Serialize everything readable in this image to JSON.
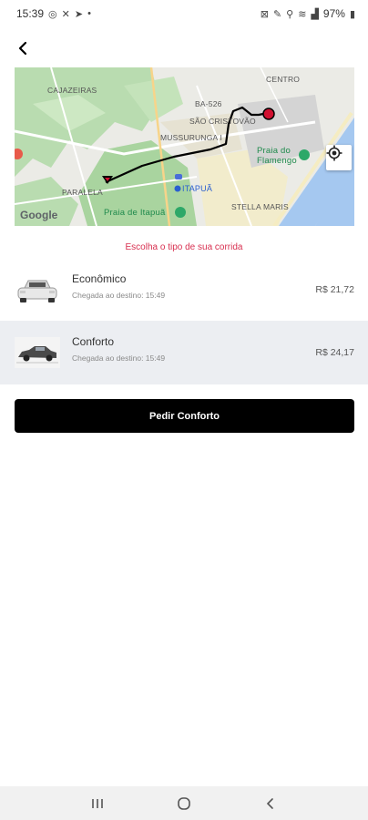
{
  "status_bar": {
    "time": "15:39",
    "battery": "97%"
  },
  "map": {
    "labels": {
      "cajazeiras": "CAJAZEIRAS",
      "centro": "CENTRO",
      "ba526": "BA-526",
      "sao_cristovao": "SÃO CRISTOVÃO",
      "mussurunga": "MUSSURUNGA I",
      "paralela": "PARALELA",
      "itapua": "ITAPUÃ",
      "stella_maris": "STELLA MARIS",
      "praia_flamengo": "Praia do\nFlamengo",
      "praia_itapua": "Praia de Itapuã"
    },
    "attribution": "Google"
  },
  "choose_label": "Escolha o tipo de sua corrida",
  "options": [
    {
      "name": "Econômico",
      "arrival": "Chegada ao destino: 15:49",
      "price": "R$ 21,72",
      "selected": false
    },
    {
      "name": "Conforto",
      "arrival": "Chegada ao destino: 15:49",
      "price": "R$ 24,17",
      "selected": true
    }
  ],
  "cta_label": "Pedir Conforto",
  "colors": {
    "accent": "#d83050",
    "button": "#000000",
    "route": "#000000",
    "origin_pin": "#d01030"
  }
}
